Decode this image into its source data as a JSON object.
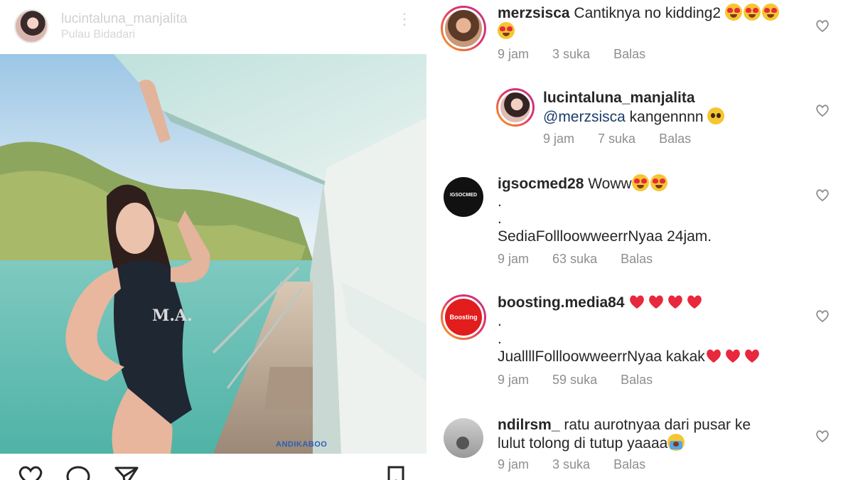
{
  "post": {
    "username": "lucintaluna_manjalita",
    "location": "Pulau Bidadari",
    "more_glyph": "⋮",
    "watermark": "ANDIKABOO"
  },
  "colors": {
    "link": "#1c3d6b",
    "meta": "#8e8e8e",
    "love": "#e8283d"
  },
  "comments": [
    {
      "user": "merzsisca",
      "text": "Cantiknya no kidding2",
      "emojis": [
        "heart-eyes",
        "heart-eyes",
        "heart-eyes",
        "heart-eyes"
      ],
      "time": "9 jam",
      "likes": "3 suka",
      "reply": "Balas"
    },
    {
      "user": "lucintaluna_manjalita",
      "mention": "@merzsisca",
      "text": "kangennnn",
      "emojis": [
        "pleading-face"
      ],
      "time": "9 jam",
      "likes": "7 suka",
      "reply": "Balas"
    },
    {
      "user": "igsocmed28",
      "text": "Woww",
      "emojis": [
        "heart-eyes",
        "heart-eyes"
      ],
      "line2": ".",
      "line3": ".",
      "line4": "SediaFollloowweerrNyaa 24jam.",
      "avatar_text": "IGSOCMED",
      "time": "9 jam",
      "likes": "63 suka",
      "reply": "Balas"
    },
    {
      "user": "boosting.media84",
      "emojis": [
        "red-heart",
        "red-heart",
        "red-heart",
        "red-heart"
      ],
      "line2": ".",
      "line3": ".",
      "line4": "JuallllFollloowweerrNyaa kakak",
      "line4_emojis": [
        "red-heart",
        "red-heart",
        "red-heart"
      ],
      "avatar_text": "Boosting",
      "time": "9 jam",
      "likes": "59 suka",
      "reply": "Balas"
    },
    {
      "user": "ndilrsm_",
      "text": "ratu aurotnyaa dari pusar ke",
      "line2": "lulut tolong di tutup yaaaa",
      "emojis": [
        "crying-face"
      ],
      "time": "9 jam",
      "likes": "3 suka",
      "reply": "Balas"
    }
  ]
}
